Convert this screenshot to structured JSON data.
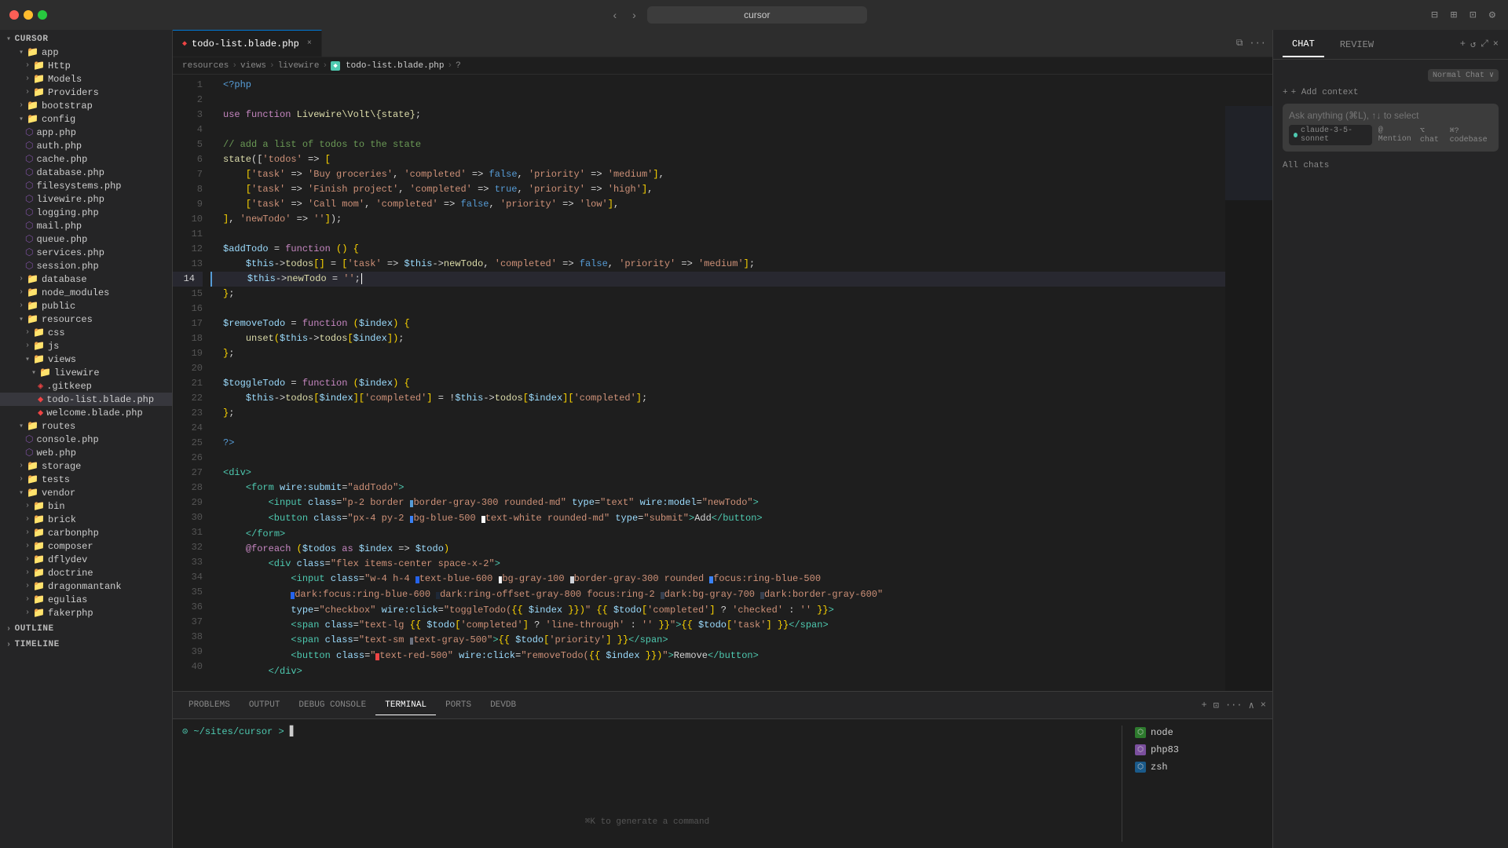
{
  "titlebar": {
    "search_placeholder": "cursor",
    "nav_back": "‹",
    "nav_forward": "›"
  },
  "tabs": [
    {
      "label": "todo-list.blade.php",
      "active": true,
      "type": "blade"
    }
  ],
  "breadcrumb": {
    "items": [
      "resources",
      "views",
      "livewire",
      "todo-list.blade.php",
      "?"
    ]
  },
  "sidebar": {
    "root": "CURSOR",
    "items": [
      {
        "label": "app",
        "type": "folder",
        "indent": 1,
        "expanded": true
      },
      {
        "label": "Http",
        "type": "folder",
        "indent": 2,
        "expanded": false
      },
      {
        "label": "Models",
        "type": "folder",
        "indent": 2,
        "expanded": false
      },
      {
        "label": "Providers",
        "type": "folder",
        "indent": 2,
        "expanded": false
      },
      {
        "label": "bootstrap",
        "type": "folder",
        "indent": 1,
        "expanded": false
      },
      {
        "label": "config",
        "type": "folder",
        "indent": 1,
        "expanded": true
      },
      {
        "label": "app.php",
        "type": "php",
        "indent": 2
      },
      {
        "label": "auth.php",
        "type": "php",
        "indent": 2
      },
      {
        "label": "cache.php",
        "type": "php",
        "indent": 2
      },
      {
        "label": "database.php",
        "type": "php",
        "indent": 2
      },
      {
        "label": "filesystems.php",
        "type": "php",
        "indent": 2
      },
      {
        "label": "livewire.php",
        "type": "php",
        "indent": 2
      },
      {
        "label": "logging.php",
        "type": "php",
        "indent": 2
      },
      {
        "label": "mail.php",
        "type": "php",
        "indent": 2
      },
      {
        "label": "queue.php",
        "type": "php",
        "indent": 2
      },
      {
        "label": "services.php",
        "type": "php",
        "indent": 2
      },
      {
        "label": "session.php",
        "type": "php",
        "indent": 2
      },
      {
        "label": "database",
        "type": "folder",
        "indent": 1,
        "expanded": false
      },
      {
        "label": "node_modules",
        "type": "folder",
        "indent": 1,
        "expanded": false
      },
      {
        "label": "public",
        "type": "folder",
        "indent": 1,
        "expanded": false
      },
      {
        "label": "resources",
        "type": "folder",
        "indent": 1,
        "expanded": true
      },
      {
        "label": "css",
        "type": "folder",
        "indent": 2,
        "expanded": false
      },
      {
        "label": "js",
        "type": "folder",
        "indent": 2,
        "expanded": false
      },
      {
        "label": "views",
        "type": "folder",
        "indent": 2,
        "expanded": true
      },
      {
        "label": "livewire",
        "type": "folder",
        "indent": 3,
        "expanded": true
      },
      {
        "label": ".gitkeep",
        "type": "git",
        "indent": 4
      },
      {
        "label": "todo-list.blade.php",
        "type": "blade",
        "indent": 4,
        "active": true
      },
      {
        "label": "welcome.blade.php",
        "type": "blade",
        "indent": 4
      },
      {
        "label": "routes",
        "type": "folder",
        "indent": 1,
        "expanded": true
      },
      {
        "label": "console.php",
        "type": "php",
        "indent": 2
      },
      {
        "label": "web.php",
        "type": "php",
        "indent": 2
      },
      {
        "label": "storage",
        "type": "folder",
        "indent": 1,
        "expanded": false
      },
      {
        "label": "tests",
        "type": "folder",
        "indent": 1,
        "expanded": false
      },
      {
        "label": "vendor",
        "type": "folder",
        "indent": 1,
        "expanded": true
      },
      {
        "label": "bin",
        "type": "folder",
        "indent": 2,
        "expanded": false
      },
      {
        "label": "brick",
        "type": "folder",
        "indent": 2,
        "expanded": false
      },
      {
        "label": "carbonphp",
        "type": "folder",
        "indent": 2,
        "expanded": false
      },
      {
        "label": "composer",
        "type": "folder",
        "indent": 2,
        "expanded": false
      },
      {
        "label": "dflydev",
        "type": "folder",
        "indent": 2,
        "expanded": false
      },
      {
        "label": "doctrine",
        "type": "folder",
        "indent": 2,
        "expanded": false
      },
      {
        "label": "dragonmantank",
        "type": "folder",
        "indent": 2,
        "expanded": false
      },
      {
        "label": "egulias",
        "type": "folder",
        "indent": 2,
        "expanded": false
      },
      {
        "label": "fakerphp",
        "type": "folder",
        "indent": 2,
        "expanded": false
      }
    ],
    "sections": {
      "outline": "OUTLINE",
      "timeline": "TIMELINE"
    }
  },
  "code_lines": [
    {
      "num": 1,
      "text": "<?php"
    },
    {
      "num": 2,
      "text": ""
    },
    {
      "num": 3,
      "text": "use function Livewire\\Volt\\{state};"
    },
    {
      "num": 4,
      "text": ""
    },
    {
      "num": 5,
      "text": "// add a list of todos to the state"
    },
    {
      "num": 6,
      "text": "state(['todos' => ["
    },
    {
      "num": 7,
      "text": "    ['task' => 'Buy groceries', 'completed' => false, 'priority' => 'medium'],"
    },
    {
      "num": 8,
      "text": "    ['task' => 'Finish project', 'completed' => true, 'priority' => 'high'],"
    },
    {
      "num": 9,
      "text": "    ['task' => 'Call mom', 'completed' => false, 'priority' => 'low'],"
    },
    {
      "num": 10,
      "text": "], 'newTodo' => '']);"
    },
    {
      "num": 11,
      "text": ""
    },
    {
      "num": 12,
      "text": "$addTodo = function () {"
    },
    {
      "num": 13,
      "text": "    $this->todos[] = ['task' => $this->newTodo, 'completed' => false, 'priority' => 'medium'];"
    },
    {
      "num": 14,
      "text": "    $this->newTodo = '';",
      "cursor": true
    },
    {
      "num": 15,
      "text": "};"
    },
    {
      "num": 16,
      "text": ""
    },
    {
      "num": 17,
      "text": "$removeTodo = function ($index) {"
    },
    {
      "num": 18,
      "text": "    unset($this->todos[$index]);"
    },
    {
      "num": 19,
      "text": "};"
    },
    {
      "num": 20,
      "text": ""
    },
    {
      "num": 21,
      "text": "$toggleTodo = function ($index) {"
    },
    {
      "num": 22,
      "text": "    $this->todos[$index]['completed'] = !$this->todos[$index]['completed'];"
    },
    {
      "num": 23,
      "text": "};"
    },
    {
      "num": 24,
      "text": ""
    },
    {
      "num": 25,
      "text": "?>"
    },
    {
      "num": 26,
      "text": ""
    },
    {
      "num": 27,
      "text": "<div>"
    },
    {
      "num": 28,
      "text": "    <form wire:submit=\"addTodo\">"
    },
    {
      "num": 29,
      "text": "        <input class=\"p-2 border ■border-gray-300 rounded-md\" type=\"text\" wire:model=\"newTodo\">"
    },
    {
      "num": 30,
      "text": "        <button class=\"px-4 py-2 ■bg-blue-500 ■text-white rounded-md\" type=\"submit\">Add</button>"
    },
    {
      "num": 31,
      "text": "    </form>"
    },
    {
      "num": 32,
      "text": "    @foreach ($todos as $index => $todo)"
    },
    {
      "num": 33,
      "text": "        <div class=\"flex items-center space-x-2\">"
    },
    {
      "num": 34,
      "text": "            <input class=\"w-4 h-4 ■text-blue-600 ■bg-gray-100 ■border-gray-300 rounded ■focus:ring-blue-500"
    },
    {
      "num": 35,
      "text": "            ■dark:focus:ring-blue-600 □dark:ring-offset-gray-800 focus:ring-2 □dark:bg-gray-700 □dark:border-gray-600\""
    },
    {
      "num": 36,
      "text": "            type=\"checkbox\" wire:click=\"toggleTodo({{ $index }})\" {{ $todo['completed'] ? 'checked' : '' }}>"
    },
    {
      "num": 37,
      "text": "            <span class=\"text-lg {{ $todo['completed'] ? 'line-through' : '' }}\">{{ $todo['task'] }}</span>"
    },
    {
      "num": 38,
      "text": "            <span class=\"text-sm ■text-gray-500\">{{ $todo['priority'] }}</span>"
    },
    {
      "num": 39,
      "text": "            <button class=\"■text-red-500\" wire:click=\"removeTodo({{ $index }})\">Remove</button>"
    },
    {
      "num": 40,
      "text": "        </div>"
    }
  ],
  "terminal": {
    "tabs": [
      "PROBLEMS",
      "OUTPUT",
      "DEBUG CONSOLE",
      "TERMINAL",
      "PORTS",
      "DEVDB"
    ],
    "active_tab": "TERMINAL",
    "prompt": "~/sites/cursor > []",
    "sessions": [
      {
        "label": "node",
        "type": "node"
      },
      {
        "label": "php83",
        "type": "php"
      },
      {
        "label": "zsh",
        "type": "zsh"
      }
    ],
    "status": "⌘K to generate a command"
  },
  "right_panel": {
    "tabs": [
      "CHAT",
      "REVIEW"
    ],
    "active_tab": "CHAT",
    "add_context": "+ Add context",
    "input_placeholder": "Ask anything (⌘L), ↑↓ to select",
    "model": "claude-3-5-sonnet",
    "mention": "@ Mention",
    "chat_shortcut": "⌥ chat",
    "codebase_shortcut": "⌘? codebase",
    "all_chats": "All chats",
    "normal_chat": "Normal Chat ∨"
  }
}
